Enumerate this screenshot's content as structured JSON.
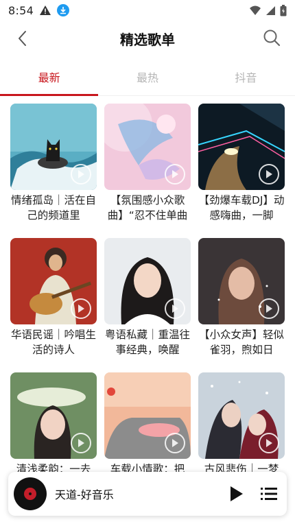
{
  "status": {
    "time": "8:54"
  },
  "header": {
    "title": "精选歌单"
  },
  "tabs": [
    {
      "label": "最新",
      "active": true
    },
    {
      "label": "最热",
      "active": false
    },
    {
      "label": "抖音",
      "active": false
    }
  ],
  "playlists": [
    {
      "title": "情绪孤岛｜活在自己的频道里"
    },
    {
      "title": "【氛围感小众歌曲】“忍不住单曲"
    },
    {
      "title": "【劲爆车载DJ】动感嗨曲，一脚"
    },
    {
      "title": "华语民谣｜吟唱生活的诗人"
    },
    {
      "title": "粤语私藏｜重温往事经典，唤醒"
    },
    {
      "title": "【小众女声】轻似雀羽，煦如日"
    },
    {
      "title": "清浅柔韵：一去"
    },
    {
      "title": "车载小情歌：把"
    },
    {
      "title": "古风悲伤｜一梦"
    }
  ],
  "player": {
    "song": "天道-好音乐"
  },
  "colors": {
    "accent": "#c8161d",
    "tab_inactive": "#b5b5b5"
  }
}
